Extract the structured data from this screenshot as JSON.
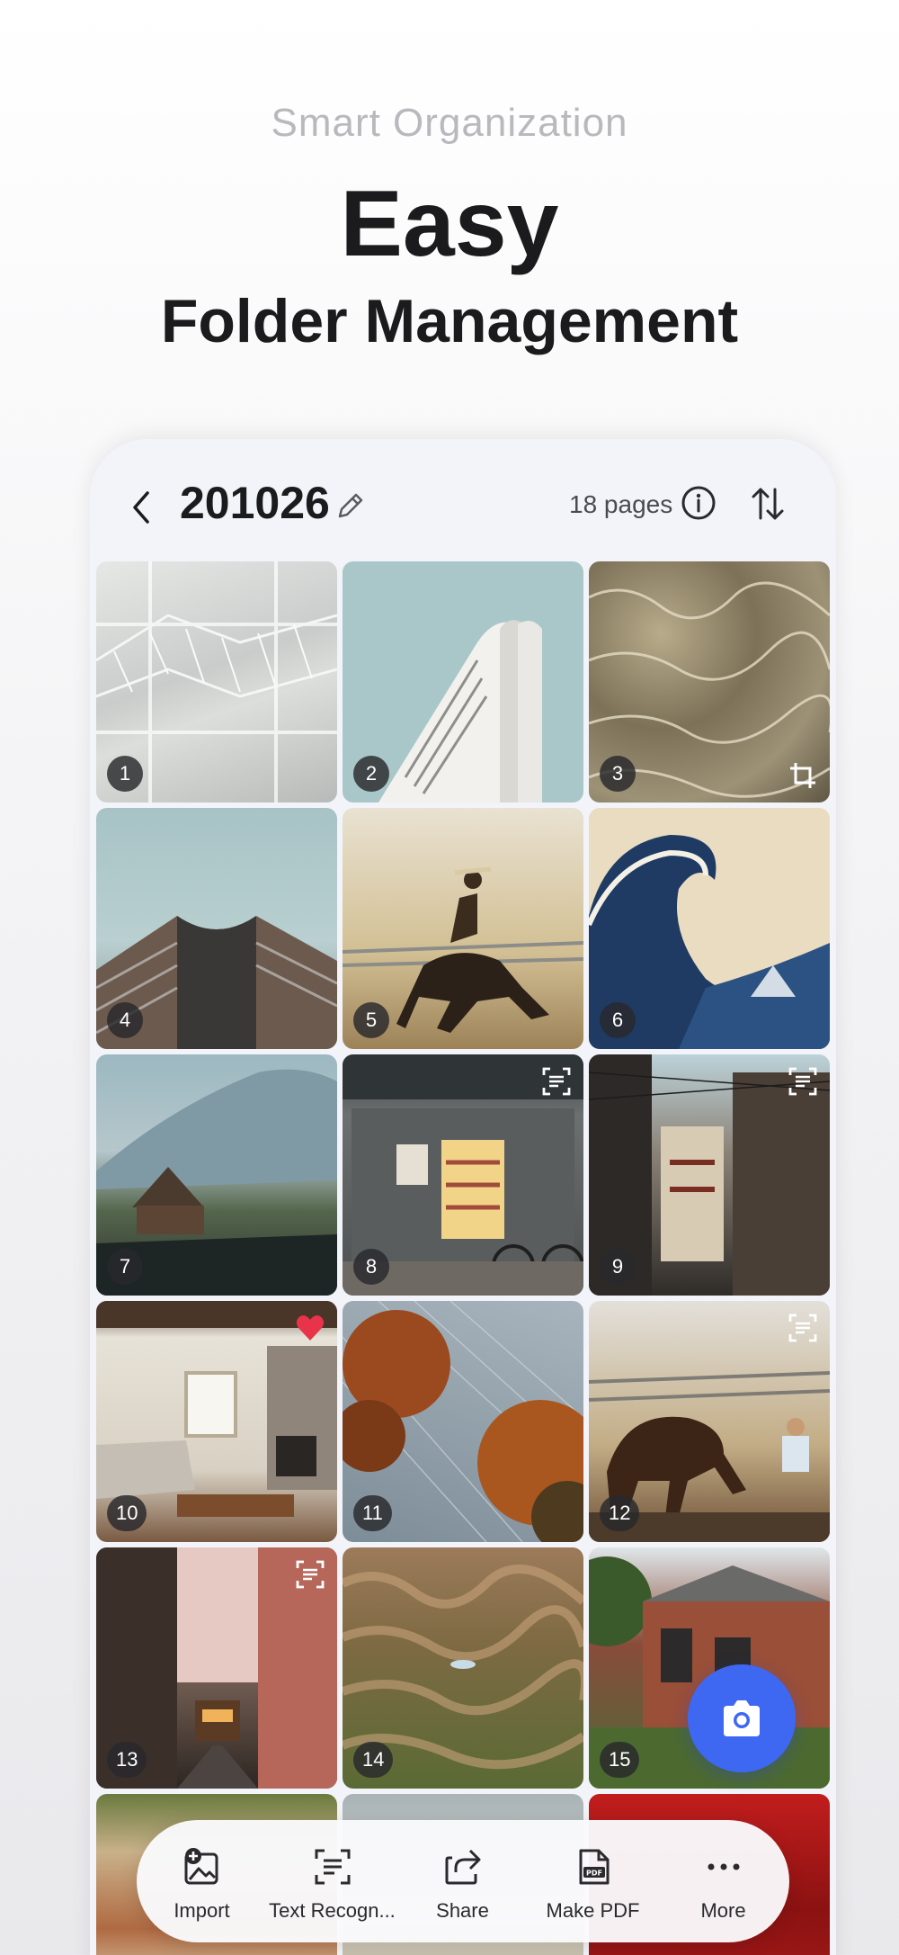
{
  "promo": {
    "subtitle": "Smart Organization",
    "title": "Easy",
    "title2": "Folder Management"
  },
  "folder": {
    "name": "201026",
    "page_count": "18 pages"
  },
  "icons": {
    "back": "chevron-left-icon",
    "edit": "pencil-icon",
    "info": "info-icon",
    "sort": "sort-icon",
    "camera": "camera-icon"
  },
  "thumbnails": [
    {
      "number": "1",
      "subject": "steel truss structure"
    },
    {
      "number": "2",
      "subject": "white tower building"
    },
    {
      "number": "3",
      "subject": "water caustics",
      "badge": "crop"
    },
    {
      "number": "4",
      "subject": "curved modern building"
    },
    {
      "number": "5",
      "subject": "rodeo rider"
    },
    {
      "number": "6",
      "subject": "great wave"
    },
    {
      "number": "7",
      "subject": "cabin by mountain lake"
    },
    {
      "number": "8",
      "subject": "vending machine storefront",
      "badge": "text"
    },
    {
      "number": "9",
      "subject": "narrow street",
      "badge": "text"
    },
    {
      "number": "10",
      "subject": "living room",
      "badge": "favorite"
    },
    {
      "number": "11",
      "subject": "autumn trees star trails"
    },
    {
      "number": "12",
      "subject": "rodeo horse",
      "badge": "text"
    },
    {
      "number": "13",
      "subject": "tram street",
      "badge": "text"
    },
    {
      "number": "14",
      "subject": "sand dunes"
    },
    {
      "number": "15",
      "subject": "brick house"
    }
  ],
  "toolbar": {
    "items": [
      {
        "label": "Import",
        "icon": "import-image-icon"
      },
      {
        "label": "Text Recogn...",
        "icon": "text-recognition-icon"
      },
      {
        "label": "Share",
        "icon": "share-icon"
      },
      {
        "label": "Make PDF",
        "icon": "pdf-icon"
      },
      {
        "label": "More",
        "icon": "more-icon"
      }
    ]
  },
  "colors": {
    "accent": "#3e68f2",
    "favorite": "#e8334a"
  }
}
